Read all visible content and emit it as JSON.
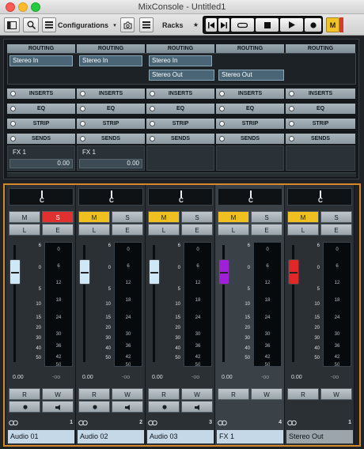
{
  "window": {
    "title": "MixConsole - Untitled1"
  },
  "toolbar": {
    "configurations": "Configurations",
    "racks": "Racks",
    "star": "★",
    "m_label": "M"
  },
  "rack": {
    "routing_header": "ROUTING",
    "routing_inputs": [
      "Stereo In",
      "Stereo In",
      "Stereo In"
    ],
    "routing_outputs": [
      "Stereo Out",
      "Stereo Out"
    ],
    "inserts": "INSERTS",
    "eq": "EQ",
    "strip": "STRIP",
    "sends": "SENDS",
    "send_names": [
      "FX 1",
      "FX 1"
    ],
    "send_values": [
      "0.00",
      "0.00"
    ]
  },
  "channels": [
    {
      "name": "Audio 01",
      "number": "1",
      "pan": "C",
      "m": "M",
      "s": "S",
      "l": "L",
      "e": "E",
      "r": "R",
      "w": "W",
      "vol": "0.00",
      "peak": "-oo",
      "s_active": true,
      "m_active": false,
      "fader_color": "#cfe8f8",
      "fader_level": 0.5
    },
    {
      "name": "Audio 02",
      "number": "2",
      "pan": "C",
      "m": "M",
      "s": "S",
      "l": "L",
      "e": "E",
      "r": "R",
      "w": "W",
      "vol": "0.00",
      "peak": "-oo",
      "s_active": false,
      "m_active": true,
      "fader_color": "#cfe8f8",
      "fader_level": 0.5
    },
    {
      "name": "Audio 03",
      "number": "3",
      "pan": "C",
      "m": "M",
      "s": "S",
      "l": "L",
      "e": "E",
      "r": "R",
      "w": "W",
      "vol": "0.00",
      "peak": "-oo",
      "s_active": false,
      "m_active": true,
      "fader_color": "#cfe8f8",
      "fader_level": 0.5
    },
    {
      "name": "FX 1",
      "number": "4",
      "pan": "C",
      "m": "M",
      "s": "S",
      "l": "L",
      "e": "E",
      "r": "R",
      "w": "W",
      "vol": "0.00",
      "peak": "-oo",
      "s_active": false,
      "m_active": true,
      "fader_color": "#a020d8",
      "fader_level": 0.5
    },
    {
      "name": "Stereo Out",
      "number": "1",
      "pan": "C",
      "m": "M",
      "s": "S",
      "l": "L",
      "e": "E",
      "r": "R",
      "w": "W",
      "vol": "0.00",
      "peak": "-oo",
      "s_active": false,
      "m_active": true,
      "fader_color": "#e02828",
      "fader_level": 0.5
    }
  ],
  "scale": [
    "6",
    "0",
    "5",
    "10",
    "15",
    "20",
    "30",
    "40",
    "50"
  ],
  "meter_scale": [
    "0",
    "6",
    "12",
    "18",
    "24",
    "30",
    "36",
    "42",
    "50"
  ],
  "colors": {
    "accent": "#d6892a",
    "solo": "#e03030",
    "mute": "#f0c020"
  }
}
